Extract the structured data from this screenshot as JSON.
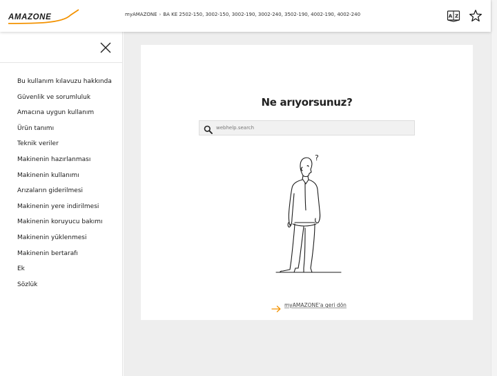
{
  "header": {
    "logo_text": "AMAZONE",
    "breadcrumb": {
      "home": "myAMAZONE",
      "separator": "›",
      "current": "BA KE 2502-150, 3002-150, 3002-190, 3002-240, 3502-190, 4002-190, 4002-240"
    },
    "icons": [
      "dictionary-icon",
      "star-icon"
    ]
  },
  "sidebar": {
    "close_icon": "close-icon",
    "items": [
      {
        "label": "Bu kullanım kılavuzu hakkında"
      },
      {
        "label": "Güvenlik ve sorumluluk"
      },
      {
        "label": "Amacına uygun kullanım"
      },
      {
        "label": "Ürün tanımı"
      },
      {
        "label": "Teknik veriler"
      },
      {
        "label": "Makinenin hazırlanması"
      },
      {
        "label": "Makinenin kullanımı"
      },
      {
        "label": "Arızaların giderilmesi"
      },
      {
        "label": "Makinenin yere indirilmesi"
      },
      {
        "label": "Makinenin koruyucu bakımı"
      },
      {
        "label": "Makinenin yüklenmesi"
      },
      {
        "label": "Makinenin bertarafı"
      },
      {
        "label": "Ek"
      },
      {
        "label": "Sözlük"
      }
    ]
  },
  "main": {
    "title": "Ne arıyorsunuz?",
    "search": {
      "placeholder": "webhelp.search",
      "value": ""
    },
    "illustration_mark": "?",
    "back_link": "myAMAZONE'a geri dön"
  },
  "colors": {
    "brand_orange": "#f39200",
    "background_gray": "#eeeeee",
    "text_dark": "#222222"
  }
}
